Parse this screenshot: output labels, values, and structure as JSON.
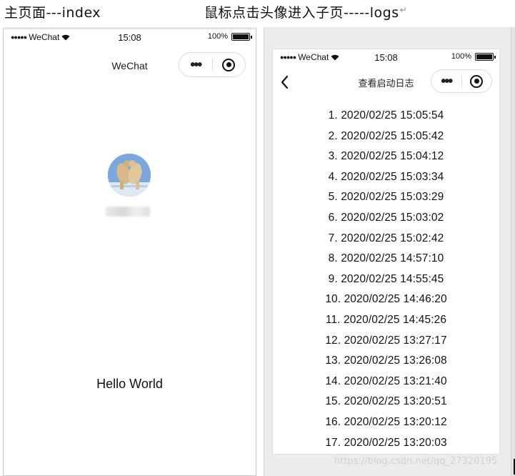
{
  "captions": {
    "left": "主页面---index",
    "right": "鼠标点击头像进入子页-----logs",
    "right_mark": "↵"
  },
  "left_phone": {
    "status": {
      "carrier": "WeChat",
      "time": "15:08",
      "battery": "100%",
      "battery_level": 1.0
    },
    "nav": {
      "title": "WeChat",
      "more": "•••"
    },
    "avatar": {
      "alt": "user avatar"
    },
    "hello": "Hello World"
  },
  "right_phone": {
    "status": {
      "carrier": "WeChat",
      "time": "15:08",
      "battery": "100%",
      "battery_level": 1.0
    },
    "nav": {
      "title": "查看启动日志",
      "more": "•••"
    },
    "logs": [
      "1. 2020/02/25 15:05:54",
      "2. 2020/02/25 15:05:42",
      "3. 2020/02/25 15:04:12",
      "4. 2020/02/25 15:03:34",
      "5. 2020/02/25 15:03:29",
      "6. 2020/02/25 15:03:02",
      "7. 2020/02/25 15:02:42",
      "8. 2020/02/25 14:57:10",
      "9. 2020/02/25 14:55:45",
      "10. 2020/02/25 14:46:20",
      "11. 2020/02/25 14:45:26",
      "12. 2020/02/25 13:27:17",
      "13. 2020/02/25 13:26:08",
      "14. 2020/02/25 13:21:40",
      "15. 2020/02/25 13:20:51",
      "16. 2020/02/25 13:20:12",
      "17. 2020/02/25 13:20:03"
    ]
  },
  "watermark": "https://blog.csdn.net/qq_27320195",
  "colors": {
    "capsule_border": "#dcdcdc",
    "avatar_bg": "#6f9fd6",
    "panel_bg": "#ececec"
  },
  "icons": {
    "back": "chevron-left-icon",
    "more": "more-dots-icon",
    "close": "target-circle-icon",
    "wifi": "wifi-icon",
    "battery": "battery-icon"
  }
}
